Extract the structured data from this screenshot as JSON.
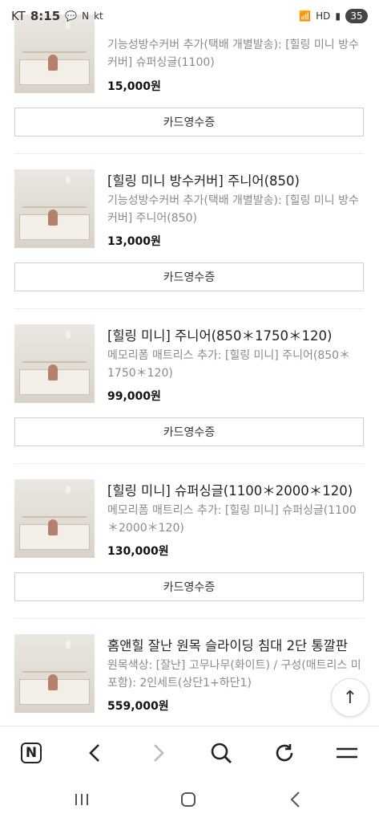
{
  "status_bar": {
    "carrier": "KT",
    "time": "8:15",
    "left_icons": [
      "talk-icon",
      "n-app-icon",
      "kt-icon"
    ],
    "right_icons": [
      "wifi-icon",
      "hd-icon",
      "signal-icon"
    ],
    "battery": "35"
  },
  "orders": [
    {
      "title": "",
      "option": "기능성방수커버 추가(택배 개별발송): [힐링 미니 방수커버] 슈퍼싱글(1100)",
      "price": "15,000원",
      "receipt_label": "카드영수증"
    },
    {
      "title": "[힐링 미니 방수커버] 주니어(850)",
      "option": "기능성방수커버 추가(택배 개별발송): [힐링 미니 방수커버] 주니어(850)",
      "price": "13,000원",
      "receipt_label": "카드영수증"
    },
    {
      "title": "[힐링 미니] 주니어(850＊1750＊120)",
      "option": "메모리폼 매트리스 추가: [힐링 미니] 주니어(850＊1750＊120)",
      "price": "99,000원",
      "receipt_label": "카드영수증"
    },
    {
      "title": "[힐링 미니] 슈퍼싱글(1100＊2000＊120)",
      "option": "메모리폼 매트리스 추가: [힐링 미니] 슈퍼싱글(1100＊2000＊120)",
      "price": "130,000원",
      "receipt_label": "카드영수증"
    },
    {
      "title": "홈앤힐 잘난 원목 슬라이딩 침대 2단 통깔판",
      "option": "원목색상: [잘난] 고무나무(화이트) / 구성(매트리스 미포함): 2인세트(상단1+하단1)",
      "price": "559,000원",
      "receipt_label": ""
    }
  ],
  "scroll_top_icon": "arrow-up-icon",
  "browser_toolbar": [
    "naver-home-icon",
    "back-icon",
    "forward-icon",
    "search-icon",
    "refresh-icon",
    "menu-icon"
  ],
  "system_nav": [
    "recent-apps-icon",
    "home-icon",
    "back-nav-icon"
  ]
}
